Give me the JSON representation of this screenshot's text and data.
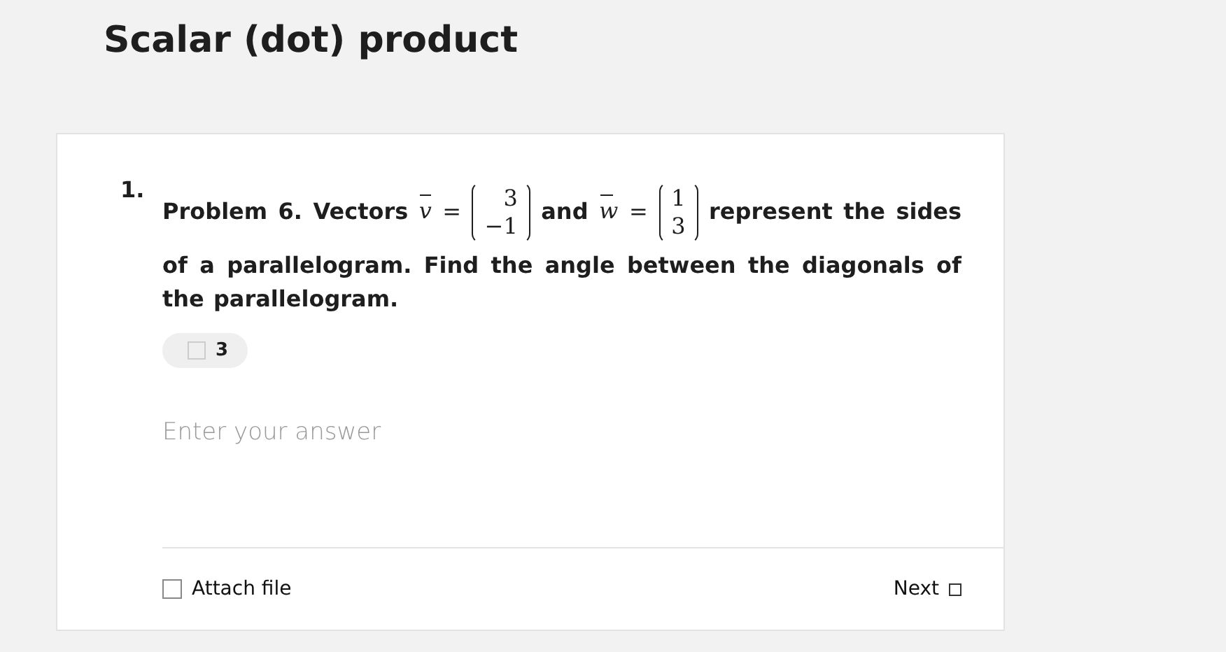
{
  "title": "Scalar (dot) product",
  "question": {
    "number": "1.",
    "parts": [
      {
        "kind": "text",
        "text": "Problem 6. Vectors"
      },
      {
        "kind": "var",
        "text": "v",
        "vector": true
      },
      {
        "kind": "rel",
        "text": "="
      },
      {
        "kind": "matrix",
        "entries": [
          "3",
          "−1"
        ]
      },
      {
        "kind": "text",
        "text": "and"
      },
      {
        "kind": "var",
        "text": "w",
        "vector": true
      },
      {
        "kind": "rel",
        "text": "="
      },
      {
        "kind": "matrix",
        "entries": [
          "1",
          "3"
        ]
      },
      {
        "kind": "text",
        "text": "represent the sides of a parallelogram. Find the angle between the diagonals of the parallelogram."
      }
    ],
    "points": "3"
  },
  "answer": {
    "placeholder": "Enter your answer"
  },
  "footer": {
    "attach": "Attach file",
    "next": "Next"
  }
}
